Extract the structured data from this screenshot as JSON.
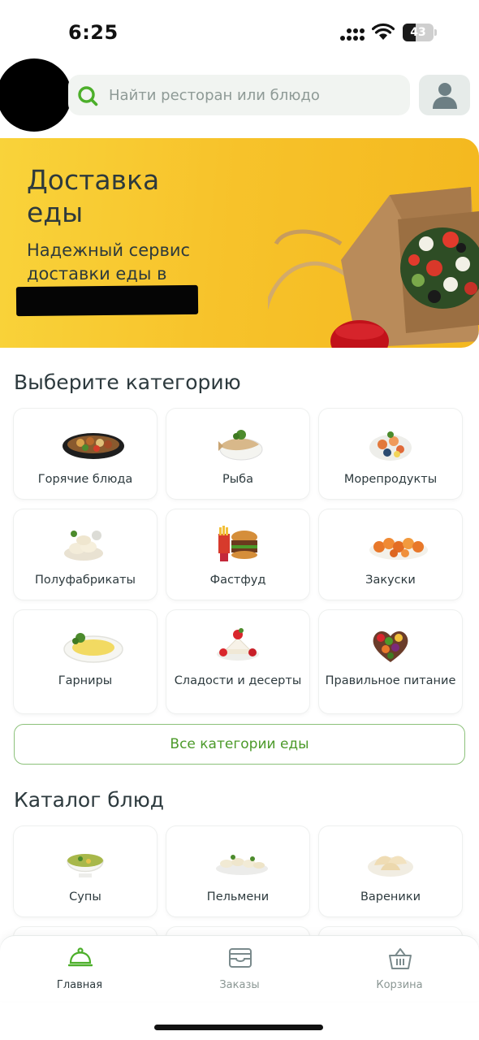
{
  "status": {
    "time": "6:25",
    "battery": "43",
    "battery_level": 0.43
  },
  "search": {
    "placeholder": "Найти ресторан или блюдо",
    "icon": "search-icon"
  },
  "banner": {
    "title": "Доставка еды",
    "subtitle": "Надежный сервис доставки еды в"
  },
  "categories": {
    "title": "Выберите категорию",
    "items": [
      {
        "label": "Горячие блюда",
        "icon": "hot-dishes-icon"
      },
      {
        "label": "Рыба",
        "icon": "fish-icon"
      },
      {
        "label": "Морепродукты",
        "icon": "seafood-icon"
      },
      {
        "label": "Полуфабрикаты",
        "icon": "semi-finished-icon"
      },
      {
        "label": "Фастфуд",
        "icon": "fastfood-icon"
      },
      {
        "label": "Закуски",
        "icon": "snacks-icon"
      },
      {
        "label": "Гарниры",
        "icon": "side-dishes-icon"
      },
      {
        "label": "Сладости и десерты",
        "icon": "desserts-icon"
      },
      {
        "label": "Правильное питание",
        "icon": "healthy-food-icon"
      }
    ],
    "all_label": "Все категории еды"
  },
  "catalog": {
    "title": "Каталог блюд",
    "items": [
      {
        "label": "Супы",
        "icon": "soup-icon"
      },
      {
        "label": "Пельмени",
        "icon": "pelmeni-icon"
      },
      {
        "label": "Вареники",
        "icon": "vareniki-icon"
      }
    ]
  },
  "nav": {
    "items": [
      {
        "label": "Главная",
        "icon": "cloche-icon",
        "active": true
      },
      {
        "label": "Заказы",
        "icon": "orders-icon",
        "active": false
      },
      {
        "label": "Корзина",
        "icon": "basket-icon",
        "active": false
      }
    ]
  },
  "colors": {
    "accent": "#4c9a2a",
    "banner": "#f7c32b",
    "text": "#2d3a3e"
  }
}
